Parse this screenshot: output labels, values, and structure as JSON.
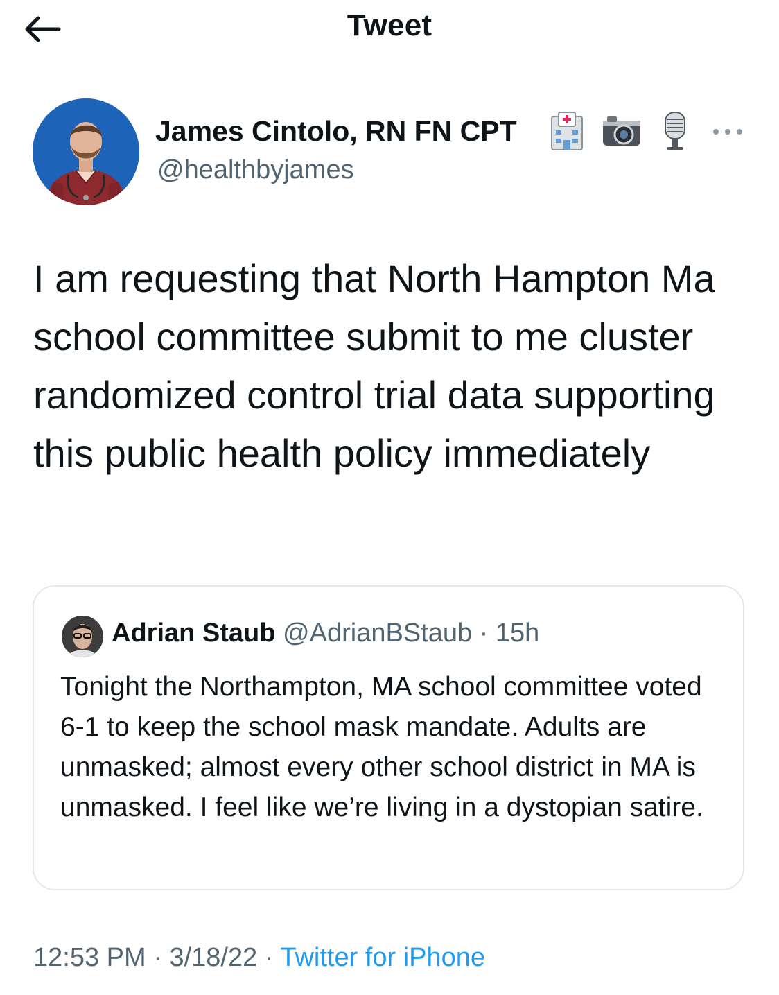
{
  "header": {
    "title": "Tweet",
    "back_icon": "arrow-left-icon"
  },
  "tweet": {
    "author_name": "James Cintolo, RN FN CPT",
    "author_emojis": [
      "hospital-icon",
      "camera-icon",
      "microphone-icon"
    ],
    "author_handle": "@healthbyjames",
    "text": "I am requesting that North Hampton Ma school committee submit to me cluster randomized control trial data supporting this public health policy immediately",
    "time": "12:53 PM",
    "separator": "·",
    "date": "3/18/22",
    "source": "Twitter for iPhone"
  },
  "quote": {
    "author_name": "Adrian Staub",
    "author_handle": "@AdrianBStaub",
    "separator": "·",
    "time": "15h",
    "text": "Tonight the Northampton, MA school committee voted 6-1 to keep the school mask mandate. Adults are unmasked; almost every other school district in MA is unmasked. I feel like we’re living in a dystopian satire."
  },
  "colors": {
    "primary_text": "#0f1419",
    "secondary_text": "#536471",
    "link": "#1d9bf0",
    "border": "#e4e8eb"
  }
}
